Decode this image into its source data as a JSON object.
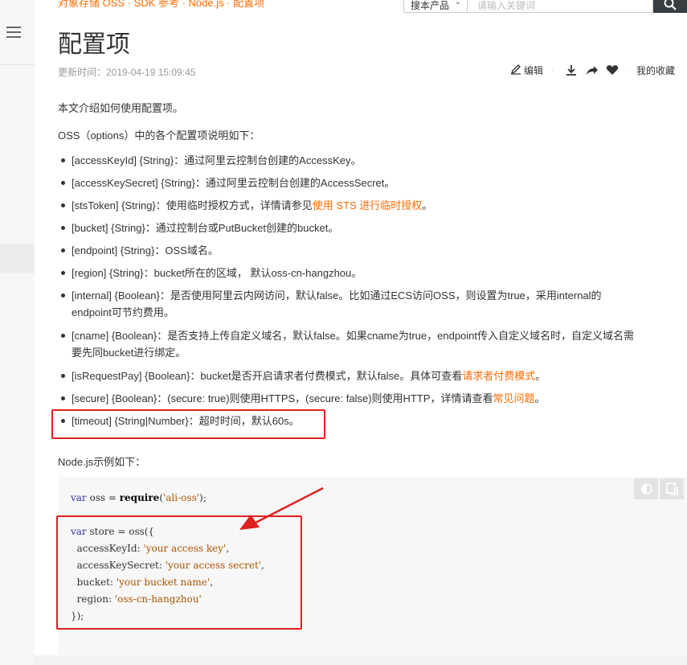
{
  "header": {
    "breadcrumb": "对象存储 OSS · SDK 参考 · Node.js · 配置项",
    "search_scope": "搜本产品",
    "search_placeholder": "请输入关键词"
  },
  "page": {
    "title": "配置项",
    "updated": "更新时间：2019-04-19 15:09:45"
  },
  "toolbar": {
    "edit": "编辑",
    "favorites": "我的收藏"
  },
  "content": {
    "intro": "本文介绍如何使用配置项。",
    "options_intro": "OSS（options）中的各个配置项说明如下：",
    "items": [
      {
        "text": "[accessKeyId] {String}：通过阿里云控制台创建的AccessKey。"
      },
      {
        "text": "[accessKeySecret] {String}：通过阿里云控制台创建的AccessSecret。"
      },
      {
        "prefix": "[stsToken] {String}：使用临时授权方式，详情请参见",
        "link": "使用 STS 进行临时授权",
        "suffix": "。"
      },
      {
        "text": "[bucket] {String}：通过控制台或PutBucket创建的bucket。"
      },
      {
        "text": "[endpoint] {String}：OSS域名。"
      },
      {
        "text": "[region] {String}：bucket所在的区域， 默认oss-cn-hangzhou。"
      },
      {
        "line1": "[internal] {Boolean}：是否使用阿里云内网访问，默认false。比如通过ECS访问OSS，则设置为true，采用internal的",
        "line2": "endpoint可节约费用。"
      },
      {
        "line1": "[cname] {Boolean}：是否支持上传自定义域名，默认false。如果cname为true，endpoint传入自定义域名时，自定义域名需",
        "line2": "要先同bucket进行绑定。"
      },
      {
        "prefix": "[isRequestPay] {Boolean}：bucket是否开启请求者付费模式，默认false。具体可查看",
        "link": "请求者付费模式",
        "suffix": "。"
      },
      {
        "prefix": "[secure] {Boolean}：(secure: true)则使用HTTPS，(secure: false)则使用HTTP，详情请查看",
        "link": "常见问题",
        "suffix": "。"
      },
      {
        "text": "[timeout] {String|Number}：超时时间，默认60s。"
      }
    ],
    "example_intro": "Node.js示例如下："
  },
  "code": {
    "line1_kw": "var",
    "line1_mid": " oss = ",
    "line1_fn": "require",
    "line1_open": "(",
    "line1_str": "'ali-oss'",
    "line1_end": ");",
    "line2_kw": "var",
    "line2_rest": " store = oss({",
    "keys": [
      {
        "key": "  accessKeyId: ",
        "value": "'your access key'",
        "end": ","
      },
      {
        "key": "  accessKeySecret: ",
        "value": "'your access secret'",
        "end": ","
      },
      {
        "key": "  bucket: ",
        "value": "'your bucket name'",
        "end": ","
      },
      {
        "key": "  region: ",
        "value": "'oss-cn-hangzhou'",
        "end": ""
      }
    ],
    "close": "});"
  },
  "colors": {
    "link": "#ff6a00",
    "annotation": "#e02020",
    "keyword": "#333399",
    "string": "#aa5500"
  }
}
